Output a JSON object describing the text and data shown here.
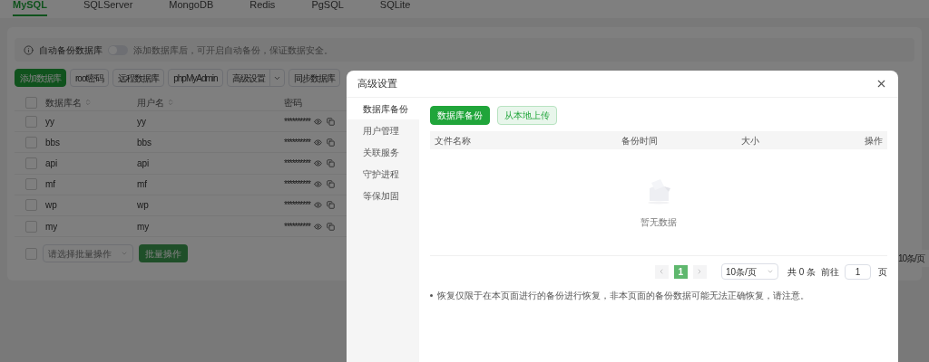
{
  "db_tabs": [
    {
      "label": "MySQL",
      "selected": true
    },
    {
      "label": "SQLServer",
      "selected": false
    },
    {
      "label": "MongoDB",
      "selected": false
    },
    {
      "label": "Redis",
      "selected": false
    },
    {
      "label": "PgSQL",
      "selected": false
    },
    {
      "label": "SQLite",
      "selected": false
    }
  ],
  "auto_backup": {
    "label": "自动备份数据库",
    "on": false,
    "hint": "添加数据库后，可开启自动备份，保证数据安全。"
  },
  "toolbar": [
    {
      "label": "添加数据库",
      "kind": "primary"
    },
    {
      "label": "root密码",
      "kind": "plain"
    },
    {
      "label": "远程数据库",
      "kind": "plain"
    },
    {
      "label": "phpMyAdmin",
      "kind": "plain"
    },
    {
      "label": "高级设置",
      "kind": "split"
    },
    {
      "label": "同步数据库",
      "kind": "plain"
    }
  ],
  "table": {
    "select_all_checked": false,
    "columns": [
      {
        "label": "数据库名",
        "sortable": true
      },
      {
        "label": "用户名",
        "sortable": true
      },
      {
        "label": "密码",
        "sortable": false
      }
    ],
    "rows": [
      {
        "name": "yy",
        "user": "yy",
        "password": "**********",
        "checked": false
      },
      {
        "name": "bbs",
        "user": "bbs",
        "password": "**********",
        "checked": false
      },
      {
        "name": "api",
        "user": "api",
        "password": "**********",
        "checked": false
      },
      {
        "name": "mf",
        "user": "mf",
        "password": "**********",
        "checked": false
      },
      {
        "name": "wp",
        "user": "wp",
        "password": "**********",
        "checked": false
      },
      {
        "name": "my",
        "user": "my",
        "password": "**********",
        "checked": false
      }
    ]
  },
  "batch": {
    "placeholder": "请选择批量操作",
    "button": "批量操作",
    "checked": false
  },
  "page_size": "10条/页",
  "dialog": {
    "title": "高级设置",
    "nav": [
      {
        "label": "数据库备份",
        "selected": true
      },
      {
        "label": "用户管理",
        "selected": false
      },
      {
        "label": "关联服务",
        "selected": false
      },
      {
        "label": "守护进程",
        "selected": false
      },
      {
        "label": "等保加固",
        "selected": false
      }
    ],
    "actions": [
      {
        "label": "数据库备份",
        "kind": "primary"
      },
      {
        "label": "从本地上传",
        "kind": "secondary"
      }
    ],
    "columns": [
      "文件名称",
      "备份时间",
      "大小",
      "操作"
    ],
    "empty": "暂无数据",
    "pagination": {
      "pages": [
        {
          "label": "1",
          "selected": true
        }
      ],
      "page_size": "10条/页",
      "total": "共 0 条",
      "goto_label": "前往",
      "goto_value": "1",
      "page_unit": "页"
    },
    "notes": [
      "恢复仅限于在本页面进行的备份进行恢复，非本页面的备份数据可能无法正确恢复，请注意。"
    ]
  }
}
